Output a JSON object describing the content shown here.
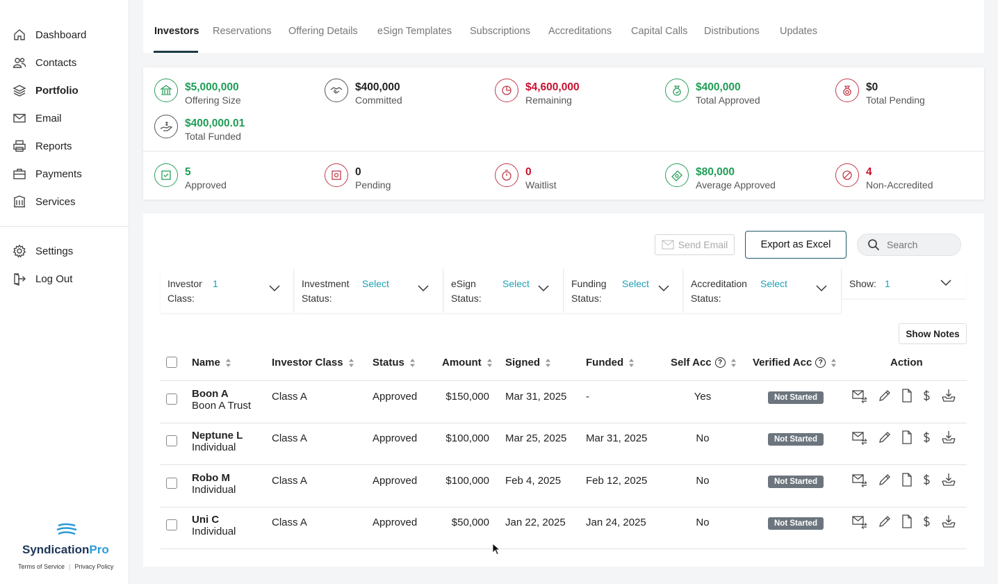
{
  "sidebar": {
    "items": [
      {
        "label": "Dashboard",
        "icon": "home-icon"
      },
      {
        "label": "Contacts",
        "icon": "users-icon"
      },
      {
        "label": "Portfolio",
        "icon": "layers-icon"
      },
      {
        "label": "Email",
        "icon": "mail-icon"
      },
      {
        "label": "Reports",
        "icon": "printer-icon"
      },
      {
        "label": "Payments",
        "icon": "briefcase-icon"
      },
      {
        "label": "Services",
        "icon": "building-icon"
      }
    ],
    "bottom_items": [
      {
        "label": "Settings",
        "icon": "gear-icon"
      },
      {
        "label": "Log Out",
        "icon": "logout-icon"
      }
    ],
    "logo": {
      "part1": "Syndication",
      "part2": "Pro"
    },
    "footer": {
      "terms": "Terms of Service",
      "privacy": "Privacy Policy"
    }
  },
  "tabs": [
    "Investors",
    "Reservations",
    "Offering Details",
    "eSign Templates",
    "Subscriptions",
    "Accreditations",
    "Capital Calls",
    "Distributions",
    "Updates"
  ],
  "stats_top": [
    {
      "value": "$5,000,000",
      "label": "Offering Size",
      "color": "green",
      "icon": "bank-icon"
    },
    {
      "value": "$400,000",
      "label": "Committed",
      "color": "black",
      "icon": "handshake-icon"
    },
    {
      "value": "$4,600,000",
      "label": "Remaining",
      "color": "red",
      "icon": "pie-chart-icon"
    },
    {
      "value": "$400,000",
      "label": "Total Approved",
      "color": "green",
      "icon": "money-bag-icon"
    },
    {
      "value": "$0",
      "label": "Total Pending",
      "color": "black",
      "icon": "pending-bag-icon"
    },
    {
      "value": "$400,000.01",
      "label": "Total Funded",
      "color": "green",
      "icon": "hand-money-icon"
    }
  ],
  "stats_bottom": [
    {
      "value": "5",
      "label": "Approved",
      "color": "teal",
      "icon": "approved-doc-icon"
    },
    {
      "value": "0",
      "label": "Pending",
      "color": "black",
      "icon": "pending-doc-icon"
    },
    {
      "value": "0",
      "label": "Waitlist",
      "color": "red",
      "icon": "stopwatch-icon"
    },
    {
      "value": "$80,000",
      "label": "Average Approved",
      "color": "green",
      "icon": "cash-icon"
    },
    {
      "value": "4",
      "label": "Non-Accredited",
      "color": "red",
      "icon": "blocked-icon"
    }
  ],
  "toolbar": {
    "send_email": "Send Email",
    "export_excel": "Export as Excel",
    "search_placeholder": "Search",
    "show_notes": "Show Notes"
  },
  "filters": [
    {
      "label1": "Investor",
      "label2": "Class:",
      "value": "1"
    },
    {
      "label1": "Investment",
      "label2": "Status:",
      "value": "Select"
    },
    {
      "label1": "eSign",
      "label2": "Status:",
      "value": "Select"
    },
    {
      "label1": "Funding",
      "label2": "Status:",
      "value": "Select"
    },
    {
      "label1": "Accreditation",
      "label2": "Status:",
      "value": "Select"
    },
    {
      "label1": "Show:",
      "label2": "",
      "value": "1"
    }
  ],
  "table": {
    "headers": [
      "Name",
      "Investor Class",
      "Status",
      "Amount",
      "Signed",
      "Funded",
      "Self Acc",
      "Verified Acc",
      "Action"
    ],
    "help_glyph": "?",
    "rows": [
      {
        "name": "Boon A",
        "entity": "Boon A Trust",
        "class": "Class A",
        "status": "Approved",
        "amount": "$150,000",
        "signed": "Mar 31, 2025",
        "funded": "-",
        "self_acc": "Yes",
        "verified": "Not Started"
      },
      {
        "name": "Neptune L",
        "entity": "Individual",
        "class": "Class A",
        "status": "Approved",
        "amount": "$100,000",
        "signed": "Mar 25, 2025",
        "funded": "Mar 31, 2025",
        "self_acc": "No",
        "verified": "Not Started"
      },
      {
        "name": "Robo M",
        "entity": "Individual",
        "class": "Class A",
        "status": "Approved",
        "amount": "$100,000",
        "signed": "Feb 4, 2025",
        "funded": "Feb 12, 2025",
        "self_acc": "No",
        "verified": "Not Started"
      },
      {
        "name": "Uni C",
        "entity": "Individual",
        "class": "Class A",
        "status": "Approved",
        "amount": "$50,000",
        "signed": "Jan 22, 2025",
        "funded": "Jan 24, 2025",
        "self_acc": "No",
        "verified": "Not Started"
      }
    ],
    "action_icons": [
      "mail-transfer-icon",
      "pencil-icon",
      "document-icon",
      "dollar-icon",
      "download-tray-icon"
    ]
  }
}
